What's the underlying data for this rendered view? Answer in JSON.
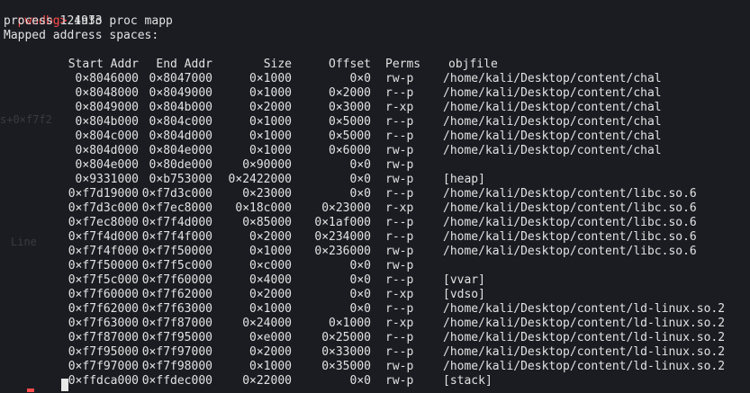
{
  "terminal": {
    "prompt": "pwndbg>",
    "command": " info proc mapp",
    "process_line": "process 124933",
    "header_line": "Mapped address spaces:"
  },
  "columns": [
    "Start Addr",
    "End Addr",
    "Size",
    "Offset",
    "Perms",
    "objfile"
  ],
  "rows": [
    [
      "0×8046000",
      "0×8047000",
      "0×1000",
      "0×0",
      "rw-p",
      "/home/kali/Desktop/content/chal"
    ],
    [
      "0×8048000",
      "0×8049000",
      "0×1000",
      "0×2000",
      "r--p",
      "/home/kali/Desktop/content/chal"
    ],
    [
      "0×8049000",
      "0×804b000",
      "0×2000",
      "0×3000",
      "r-xp",
      "/home/kali/Desktop/content/chal"
    ],
    [
      "0×804b000",
      "0×804c000",
      "0×1000",
      "0×5000",
      "r--p",
      "/home/kali/Desktop/content/chal"
    ],
    [
      "0×804c000",
      "0×804d000",
      "0×1000",
      "0×5000",
      "r--p",
      "/home/kali/Desktop/content/chal"
    ],
    [
      "0×804d000",
      "0×804e000",
      "0×1000",
      "0×6000",
      "rw-p",
      "/home/kali/Desktop/content/chal"
    ],
    [
      "0×804e000",
      "0×80de000",
      "0×90000",
      "0×0",
      "rw-p",
      ""
    ],
    [
      "0×9331000",
      "0×b753000",
      "0×2422000",
      "0×0",
      "rw-p",
      "[heap]"
    ],
    [
      "0×f7d19000",
      "0×f7d3c000",
      "0×23000",
      "0×0",
      "r--p",
      "/home/kali/Desktop/content/libc.so.6"
    ],
    [
      "0×f7d3c000",
      "0×f7ec8000",
      "0×18c000",
      "0×23000",
      "r-xp",
      "/home/kali/Desktop/content/libc.so.6"
    ],
    [
      "0×f7ec8000",
      "0×f7f4d000",
      "0×85000",
      "0×1af000",
      "r--p",
      "/home/kali/Desktop/content/libc.so.6"
    ],
    [
      "0×f7f4d000",
      "0×f7f4f000",
      "0×2000",
      "0×234000",
      "r--p",
      "/home/kali/Desktop/content/libc.so.6"
    ],
    [
      "0×f7f4f000",
      "0×f7f50000",
      "0×1000",
      "0×236000",
      "rw-p",
      "/home/kali/Desktop/content/libc.so.6"
    ],
    [
      "0×f7f50000",
      "0×f7f5c000",
      "0×c000",
      "0×0",
      "rw-p",
      ""
    ],
    [
      "0×f7f5c000",
      "0×f7f60000",
      "0×4000",
      "0×0",
      "r--p",
      "[vvar]"
    ],
    [
      "0×f7f60000",
      "0×f7f62000",
      "0×2000",
      "0×0",
      "r-xp",
      "[vdso]"
    ],
    [
      "0×f7f62000",
      "0×f7f63000",
      "0×1000",
      "0×0",
      "r--p",
      "/home/kali/Desktop/content/ld-linux.so.2"
    ],
    [
      "0×f7f63000",
      "0×f7f87000",
      "0×24000",
      "0×1000",
      "r-xp",
      "/home/kali/Desktop/content/ld-linux.so.2"
    ],
    [
      "0×f7f87000",
      "0×f7f95000",
      "0×e000",
      "0×25000",
      "r--p",
      "/home/kali/Desktop/content/ld-linux.so.2"
    ],
    [
      "0×f7f95000",
      "0×f7f97000",
      "0×2000",
      "0×33000",
      "r--p",
      "/home/kali/Desktop/content/ld-linux.so.2"
    ],
    [
      "0×f7f97000",
      "0×f7f98000",
      "0×1000",
      "0×35000",
      "rw-p",
      "/home/kali/Desktop/content/ld-linux.so.2"
    ],
    [
      "0×ffdca000",
      "0×ffdec000",
      "0×22000",
      "0×0",
      "rw-p",
      "[stack]"
    ]
  ],
  "ghost_text": {
    "a": "s+0×f7f2",
    "b": "Line"
  },
  "colors": {
    "background": "#1b1c22",
    "prompt": "#ff4a4a",
    "text": "#e2e2e2"
  }
}
